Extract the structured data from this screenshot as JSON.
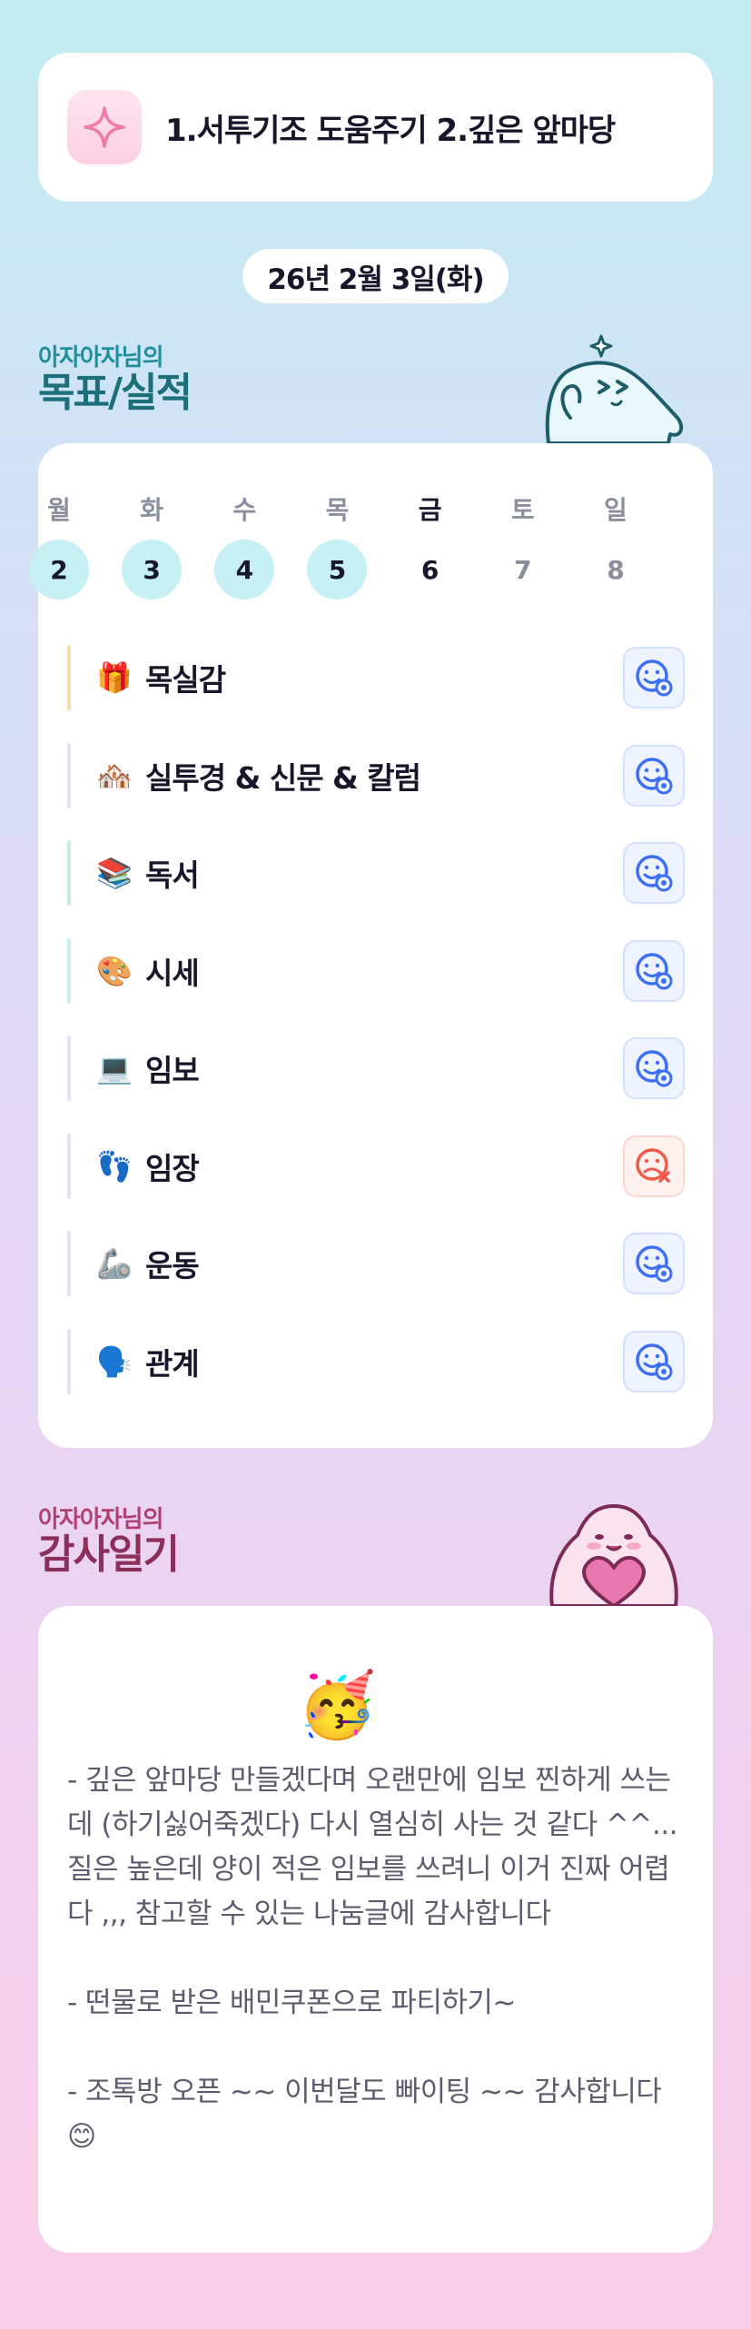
{
  "goal_banner": {
    "icon": "sparkle-icon",
    "text": "1.서투기조 도움주기 2.깊은 앞마당"
  },
  "date": "26년 2월 3일(화)",
  "goals_section": {
    "subtitle": "아자아자님의",
    "title": "목표/실적"
  },
  "week": {
    "days": [
      "월",
      "화",
      "수",
      "목",
      "금",
      "토",
      "일"
    ],
    "dates": [
      "2",
      "3",
      "4",
      "5",
      "6",
      "7",
      "8"
    ],
    "completed_dates": [
      "2",
      "3",
      "4",
      "5"
    ],
    "today_index": 4
  },
  "goals": [
    {
      "emoji": "🎁",
      "label": "목실감",
      "status": "done",
      "bar_color": "#f6dcae"
    },
    {
      "emoji": "🏘️",
      "label": "실투경 & 신문 & 칼럼",
      "status": "done",
      "bar_color": "#dfe3f8"
    },
    {
      "emoji": "📚",
      "label": "독서",
      "status": "done",
      "bar_color": "#c6ecdc"
    },
    {
      "emoji": "🎨",
      "label": "시세",
      "status": "done",
      "bar_color": "#cceef2"
    },
    {
      "emoji": "💻",
      "label": "임보",
      "status": "done",
      "bar_color": "#dfe3f8"
    },
    {
      "emoji": "👣",
      "label": "임장",
      "status": "missed",
      "bar_color": "#dfe3f8"
    },
    {
      "emoji": "🦾",
      "label": "운동",
      "status": "done",
      "bar_color": "#dfe3f8"
    },
    {
      "emoji": "🗣️",
      "label": "관계",
      "status": "done",
      "bar_color": "#dfe3f8"
    }
  ],
  "status_icons": {
    "done": "smile-check-icon",
    "missed": "sad-x-icon"
  },
  "colors": {
    "done_accent": "#3b6ff5",
    "missed_accent": "#ef5b4a",
    "completed_date_bg": "#c6f0f4"
  },
  "diary_section": {
    "subtitle": "아자아자님의",
    "title": "감사일기",
    "emoji": "🥳",
    "text": "- 깊은 앞마당 만들겠다며 오랜만에 임보 찐하게 쓰는데 (하기싫어죽겠다) 다시 열심히 사는 것 같다 ^^... 질은 높은데 양이 적은 임보를 쓰려니 이거 진짜 어렵다 ,,, 참고할 수 있는 나눔글에 감사합니다\n\n- 떤물로 받은 배민쿠폰으로 파티하기~\n\n- 조톡방 오픈 ~~ 이번달도 빠이팅 ~~ 감사합니다 😊"
  }
}
